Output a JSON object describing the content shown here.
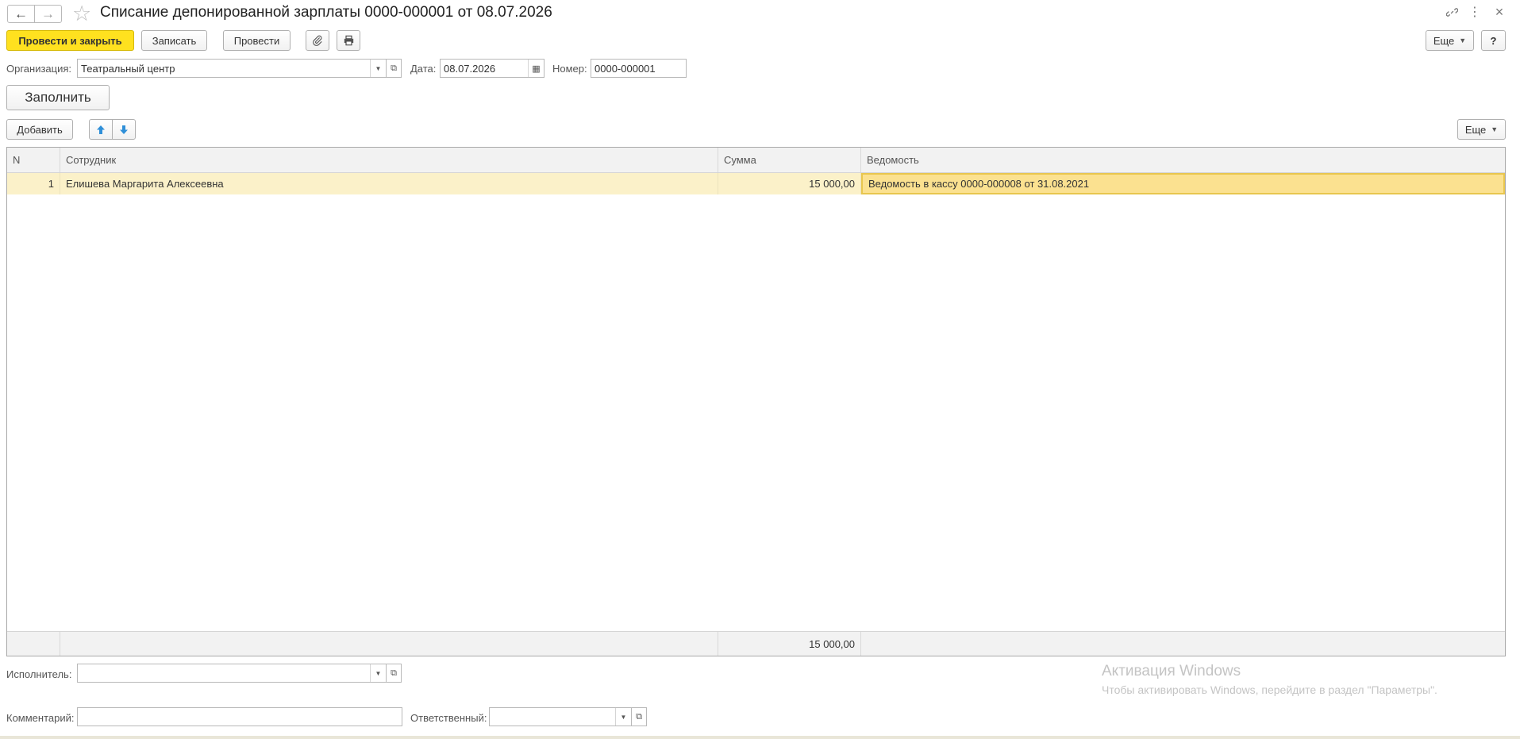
{
  "header": {
    "title": "Списание депонированной зарплаты 0000-000001 от 08.07.2026",
    "back_icon": "←",
    "forward_icon": "→",
    "star_icon": "☆",
    "link_icon": "🔗",
    "menu_icon": "⋮",
    "close_icon": "×"
  },
  "toolbar": {
    "post_close_label": "Провести и закрыть",
    "save_label": "Записать",
    "post_label": "Провести",
    "attach_icon": "📎",
    "print_icon": "🖶",
    "more_label": "Еще",
    "help_label": "?"
  },
  "form": {
    "org_label": "Организация:",
    "org_value": "Театральный центр",
    "date_label": "Дата:",
    "date_value": "08.07.2026",
    "number_label": "Номер:",
    "number_value": "0000-000001",
    "fill_label": "Заполнить"
  },
  "table_toolbar": {
    "add_label": "Добавить",
    "up_icon": "🡅",
    "down_icon": "🡇",
    "more_label": "Еще"
  },
  "table": {
    "columns": [
      "N",
      "Сотрудник",
      "Сумма",
      "Ведомость"
    ],
    "rows": [
      {
        "n": "1",
        "employee": "Елишева Маргарита Алексеевна",
        "amount": "15 000,00",
        "statement": "Ведомость в кассу 0000-000008 от 31.08.2021"
      }
    ],
    "total_amount": "15 000,00"
  },
  "footer": {
    "executor_label": "Исполнитель:",
    "executor_value": "",
    "comment_label": "Комментарий:",
    "comment_value": "",
    "responsible_label": "Ответственный:",
    "responsible_value": ""
  },
  "watermark": {
    "line1": "Активация Windows",
    "line2": "Чтобы активировать Windows, перейдите в раздел \"Параметры\"."
  },
  "colors": {
    "primary_button": "#ffe11f",
    "selected_row": "#fbf1c9",
    "active_cell": "#fbe190"
  }
}
